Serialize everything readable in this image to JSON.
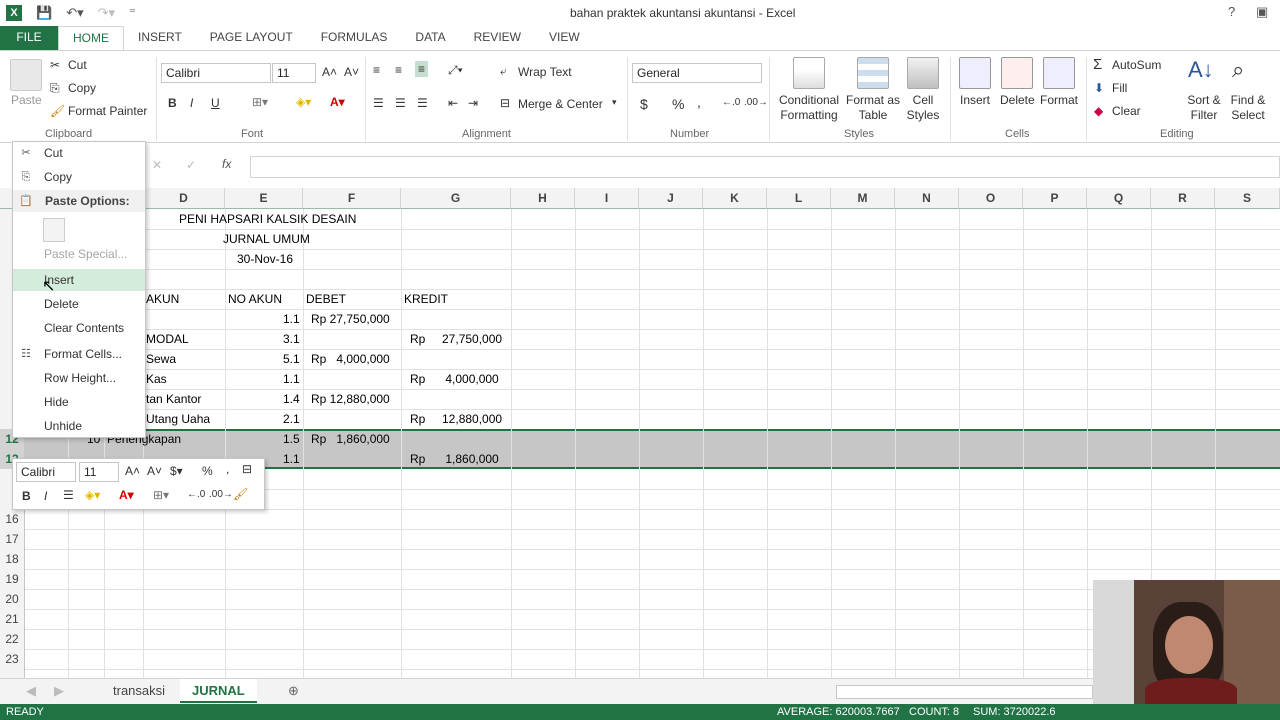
{
  "window": {
    "title": "bahan praktek akuntansi  akuntansi - Excel",
    "help": "?",
    "minimize": "–",
    "restore": "▭",
    "close": "✕"
  },
  "tabs": [
    "FILE",
    "HOME",
    "INSERT",
    "PAGE LAYOUT",
    "FORMULAS",
    "DATA",
    "REVIEW",
    "VIEW"
  ],
  "ribbon": {
    "clipboard": {
      "paste": "Paste",
      "cut": "Cut",
      "copy": "Copy",
      "format_painter": "Format Painter",
      "label": "Clipboard"
    },
    "font": {
      "name": "Calibri",
      "size": "11",
      "label": "Font",
      "bold": "B",
      "italic": "I",
      "underline": "U"
    },
    "alignment": {
      "wrap": "Wrap Text",
      "merge": "Merge & Center",
      "label": "Alignment"
    },
    "number": {
      "format": "General",
      "currency": "$",
      "percent": "%",
      "comma": ",",
      "label": "Number"
    },
    "styles": {
      "conditional": "Conditional Formatting",
      "format_table": "Format as Table",
      "cell_styles": "Cell Styles",
      "label": "Styles"
    },
    "cells": {
      "insert": "Insert",
      "delete": "Delete",
      "format": "Format",
      "label": "Cells"
    },
    "editing": {
      "autosum": "AutoSum",
      "fill": "Fill",
      "clear": "Clear",
      "sort": "Sort & Filter",
      "find": "Find & Select",
      "label": "Editing"
    }
  },
  "formula_bar": {
    "fx": "fx",
    "cancel": "✕",
    "enter": "✓"
  },
  "columns": [
    "D",
    "E",
    "F",
    "G",
    "H",
    "I",
    "J",
    "K",
    "L",
    "M",
    "N",
    "O",
    "P",
    "Q",
    "R",
    "S"
  ],
  "rows": [
    "16",
    "17",
    "18",
    "19",
    "20",
    "21",
    "22",
    "23"
  ],
  "row_partial": [
    "12",
    "13"
  ],
  "sheet": {
    "company": "PENI HAPSARI KALSIK DESAIN",
    "journal": "JURNAL UMUM",
    "date": "30-Nov-16",
    "headers": {
      "akun": "AKUN",
      "no_akun": "NO AKUN",
      "debet": "DEBET",
      "kredit": "KREDIT"
    },
    "entries": [
      {
        "akun": "",
        "no": "1.1",
        "debet": "Rp 27,750,000",
        "kredit": ""
      },
      {
        "akun": "MODAL",
        "no": "3.1",
        "debet": "",
        "kredit": "Rp     27,750,000"
      },
      {
        "akun": "Sewa",
        "no": "5.1",
        "debet": "Rp   4,000,000",
        "kredit": ""
      },
      {
        "akun": "Kas",
        "no": "1.1",
        "debet": "",
        "kredit": "Rp      4,000,000"
      },
      {
        "akun": "tan Kantor",
        "no": "1.4",
        "debet": "Rp 12,880,000",
        "kredit": ""
      },
      {
        "akun": "Utang Uaha",
        "no": "2.1",
        "debet": "",
        "kredit": "Rp     12,880,000"
      },
      {
        "akun": "10  Perlengkapan",
        "no": "1.5",
        "debet": "Rp   1,860,000",
        "kredit": ""
      },
      {
        "akun": "",
        "no": "1.1",
        "debet": "",
        "kredit": "Rp      1,860,000"
      }
    ]
  },
  "context_menu": {
    "cut": "Cut",
    "copy": "Copy",
    "paste_options": "Paste Options:",
    "paste_special": "Paste Special...",
    "insert": "Insert",
    "delete": "Delete",
    "clear": "Clear Contents",
    "format_cells": "Format Cells...",
    "row_height": "Row Height...",
    "hide": "Hide",
    "unhide": "Unhide"
  },
  "mini_toolbar": {
    "font": "Calibri",
    "size": "11"
  },
  "sheets": [
    "transaksi",
    "JURNAL"
  ],
  "status": {
    "mode": "READY",
    "average": "AVERAGE: 620003.7667",
    "count": "COUNT: 8",
    "sum": "SUM: 3720022.6"
  },
  "colors": {
    "accent": "#217346",
    "selection": "#c6c6c6",
    "menu_hover": "#d3ecdb"
  }
}
